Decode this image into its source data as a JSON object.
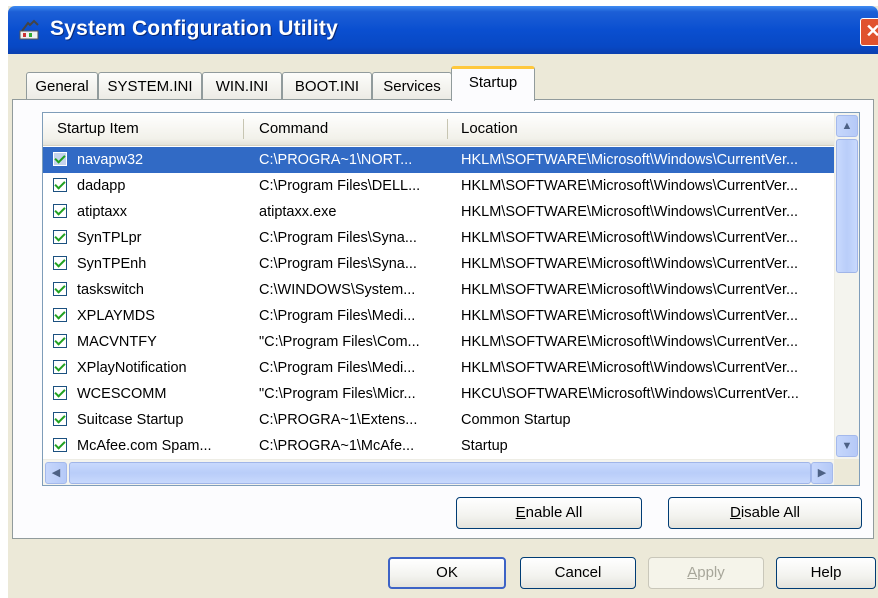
{
  "window": {
    "title": "System Configuration Utility",
    "close_glyph": "✕"
  },
  "tabs": [
    {
      "label": "General"
    },
    {
      "label": "SYSTEM.INI"
    },
    {
      "label": "WIN.INI"
    },
    {
      "label": "BOOT.INI"
    },
    {
      "label": "Services"
    },
    {
      "label": "Startup",
      "active": true
    }
  ],
  "list": {
    "columns": [
      "Startup Item",
      "Command",
      "Location"
    ],
    "rows": [
      {
        "item": "navapw32",
        "command": "C:\\PROGRA~1\\NORT...",
        "location": "HKLM\\SOFTWARE\\Microsoft\\Windows\\CurrentVer...",
        "checked": true,
        "selected": true
      },
      {
        "item": "dadapp",
        "command": "C:\\Program Files\\DELL...",
        "location": "HKLM\\SOFTWARE\\Microsoft\\Windows\\CurrentVer...",
        "checked": true
      },
      {
        "item": "atiptaxx",
        "command": "atiptaxx.exe",
        "location": "HKLM\\SOFTWARE\\Microsoft\\Windows\\CurrentVer...",
        "checked": true
      },
      {
        "item": "SynTPLpr",
        "command": "C:\\Program Files\\Syna...",
        "location": "HKLM\\SOFTWARE\\Microsoft\\Windows\\CurrentVer...",
        "checked": true
      },
      {
        "item": "SynTPEnh",
        "command": "C:\\Program Files\\Syna...",
        "location": "HKLM\\SOFTWARE\\Microsoft\\Windows\\CurrentVer...",
        "checked": true
      },
      {
        "item": "taskswitch",
        "command": "C:\\WINDOWS\\System...",
        "location": "HKLM\\SOFTWARE\\Microsoft\\Windows\\CurrentVer...",
        "checked": true
      },
      {
        "item": "XPLAYMDS",
        "command": "C:\\Program Files\\Medi...",
        "location": "HKLM\\SOFTWARE\\Microsoft\\Windows\\CurrentVer...",
        "checked": true
      },
      {
        "item": "MACVNTFY",
        "command": "\"C:\\Program Files\\Com...",
        "location": "HKLM\\SOFTWARE\\Microsoft\\Windows\\CurrentVer...",
        "checked": true
      },
      {
        "item": "XPlayNotification",
        "command": "C:\\Program Files\\Medi...",
        "location": "HKLM\\SOFTWARE\\Microsoft\\Windows\\CurrentVer...",
        "checked": true
      },
      {
        "item": "WCESCOMM",
        "command": "\"C:\\Program Files\\Micr...",
        "location": "HKCU\\SOFTWARE\\Microsoft\\Windows\\CurrentVer...",
        "checked": true
      },
      {
        "item": "Suitcase Startup",
        "command": "C:\\PROGRA~1\\Extens...",
        "location": "Common Startup",
        "checked": true
      },
      {
        "item": "McAfee.com Spam...",
        "command": "C:\\PROGRA~1\\McAfe...",
        "location": "Startup",
        "checked": true
      }
    ]
  },
  "scroll": {
    "up": "▲",
    "down": "▼",
    "left": "◀",
    "right": "▶"
  },
  "buttons": {
    "enable_all": {
      "prefix": "",
      "mnemonic": "E",
      "rest": "nable All"
    },
    "disable_all": {
      "prefix": "",
      "mnemonic": "D",
      "rest": "isable All"
    },
    "ok": "OK",
    "cancel": "Cancel",
    "apply": {
      "prefix": "",
      "mnemonic": "A",
      "rest": "pply"
    },
    "help": "Help"
  },
  "icons": {
    "title": "msconfig-icon"
  }
}
